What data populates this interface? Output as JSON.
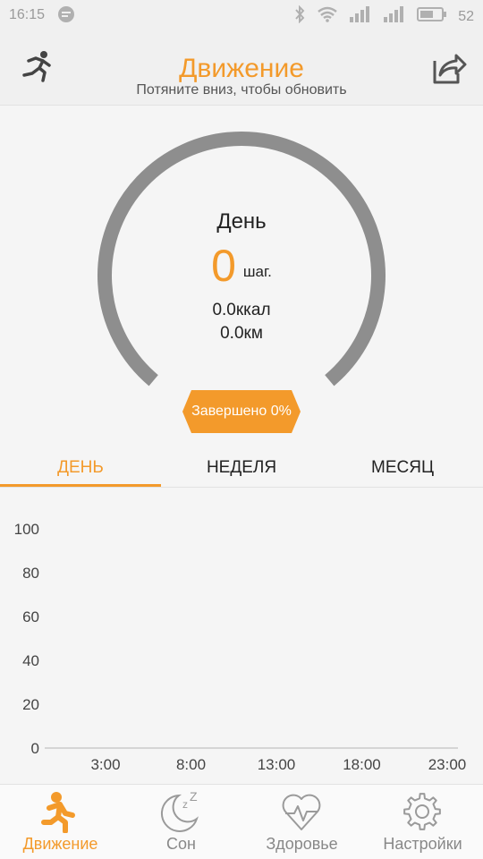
{
  "status_bar": {
    "time": "16:15",
    "battery": "52",
    "icons": [
      "chat-icon",
      "bluetooth-icon",
      "wifi-icon",
      "signal-icon",
      "signal-icon",
      "battery-icon"
    ]
  },
  "header": {
    "title": "Движение",
    "subtitle": "Потяните вниз, чтобы обновить",
    "left_icon": "running-icon",
    "right_icon": "share-icon"
  },
  "summary": {
    "period_label": "День",
    "steps": "0",
    "steps_unit": "шаг.",
    "calories": "0.0ккал",
    "distance": "0.0км",
    "completion_label": "Завершено 0%",
    "completion_fraction": 0
  },
  "tabs": [
    {
      "label": "ДЕНЬ",
      "active": true
    },
    {
      "label": "НЕДЕЛЯ",
      "active": false
    },
    {
      "label": "МЕСЯЦ",
      "active": false
    }
  ],
  "chart_data": {
    "type": "bar",
    "x_tick_labels": [
      "3:00",
      "8:00",
      "13:00",
      "18:00",
      "23:00"
    ],
    "y_tick_labels": [
      "100",
      "80",
      "60",
      "40",
      "20",
      "0"
    ],
    "ylim": [
      0,
      100
    ],
    "values": [],
    "grid": false
  },
  "bottom_nav": [
    {
      "label": "Движение",
      "icon": "running-icon",
      "active": true
    },
    {
      "label": "Сон",
      "icon": "moon-sleep-icon",
      "active": false
    },
    {
      "label": "Здоровье",
      "icon": "heart-pulse-icon",
      "active": false
    },
    {
      "label": "Настройки",
      "icon": "gear-icon",
      "active": false
    }
  ],
  "colors": {
    "accent": "#f39a2b",
    "ring": "#8e8e8e",
    "background": "#f5f5f5"
  }
}
